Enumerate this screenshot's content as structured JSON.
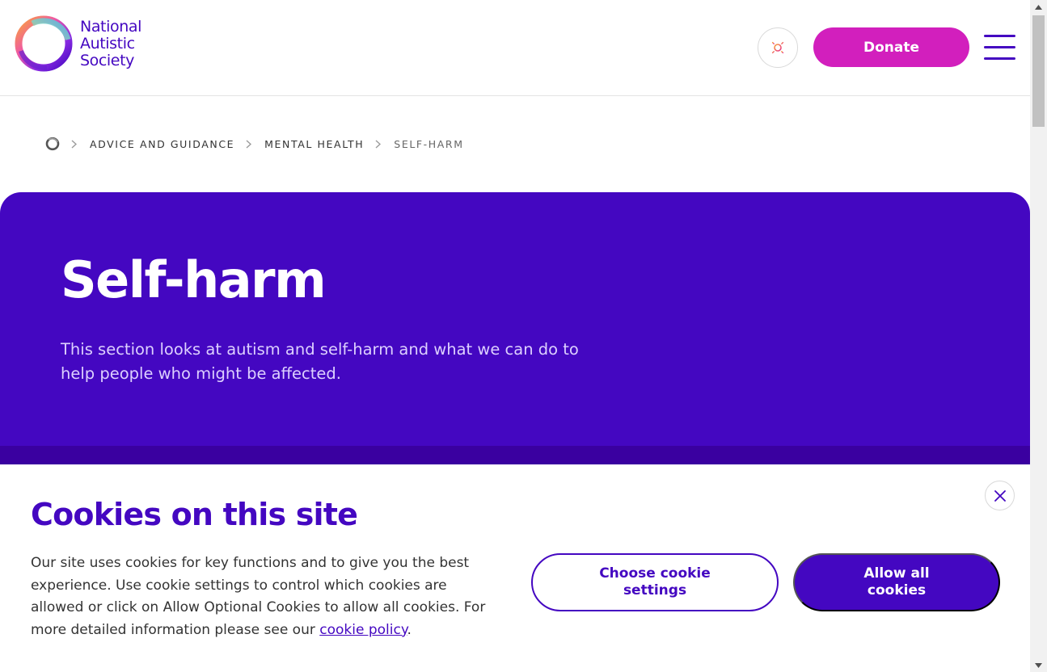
{
  "header": {
    "logo_lines": [
      "National",
      "Autistic",
      "Society"
    ],
    "theme_icon": "sun-icon",
    "donate_label": "Donate",
    "menu_icon": "hamburger-menu-icon"
  },
  "breadcrumb": {
    "home_icon": "home-logo-icon",
    "items": [
      "ADVICE AND GUIDANCE",
      "MENTAL HEALTH",
      "SELF-HARM"
    ]
  },
  "hero": {
    "title": "Self-harm",
    "description": "This section looks at autism and self-harm and what we can do to help people who might be affected."
  },
  "cookie_banner": {
    "title": "Cookies on this site",
    "text_before_link": "Our site uses cookies for key functions and to give you the best experience. Use cookie settings to control which cookies are allowed or click on Allow Optional Cookies to allow all cookies. For more detailed information please see our ",
    "link_text": "cookie policy",
    "text_after_link": ".",
    "settings_button": "Choose cookie settings",
    "allow_button": "Allow all cookies",
    "close_icon": "close-icon"
  },
  "colors": {
    "brand_purple": "#4407c1",
    "donate_pink": "#d21fbd",
    "hero_band": "#3a00a0"
  }
}
